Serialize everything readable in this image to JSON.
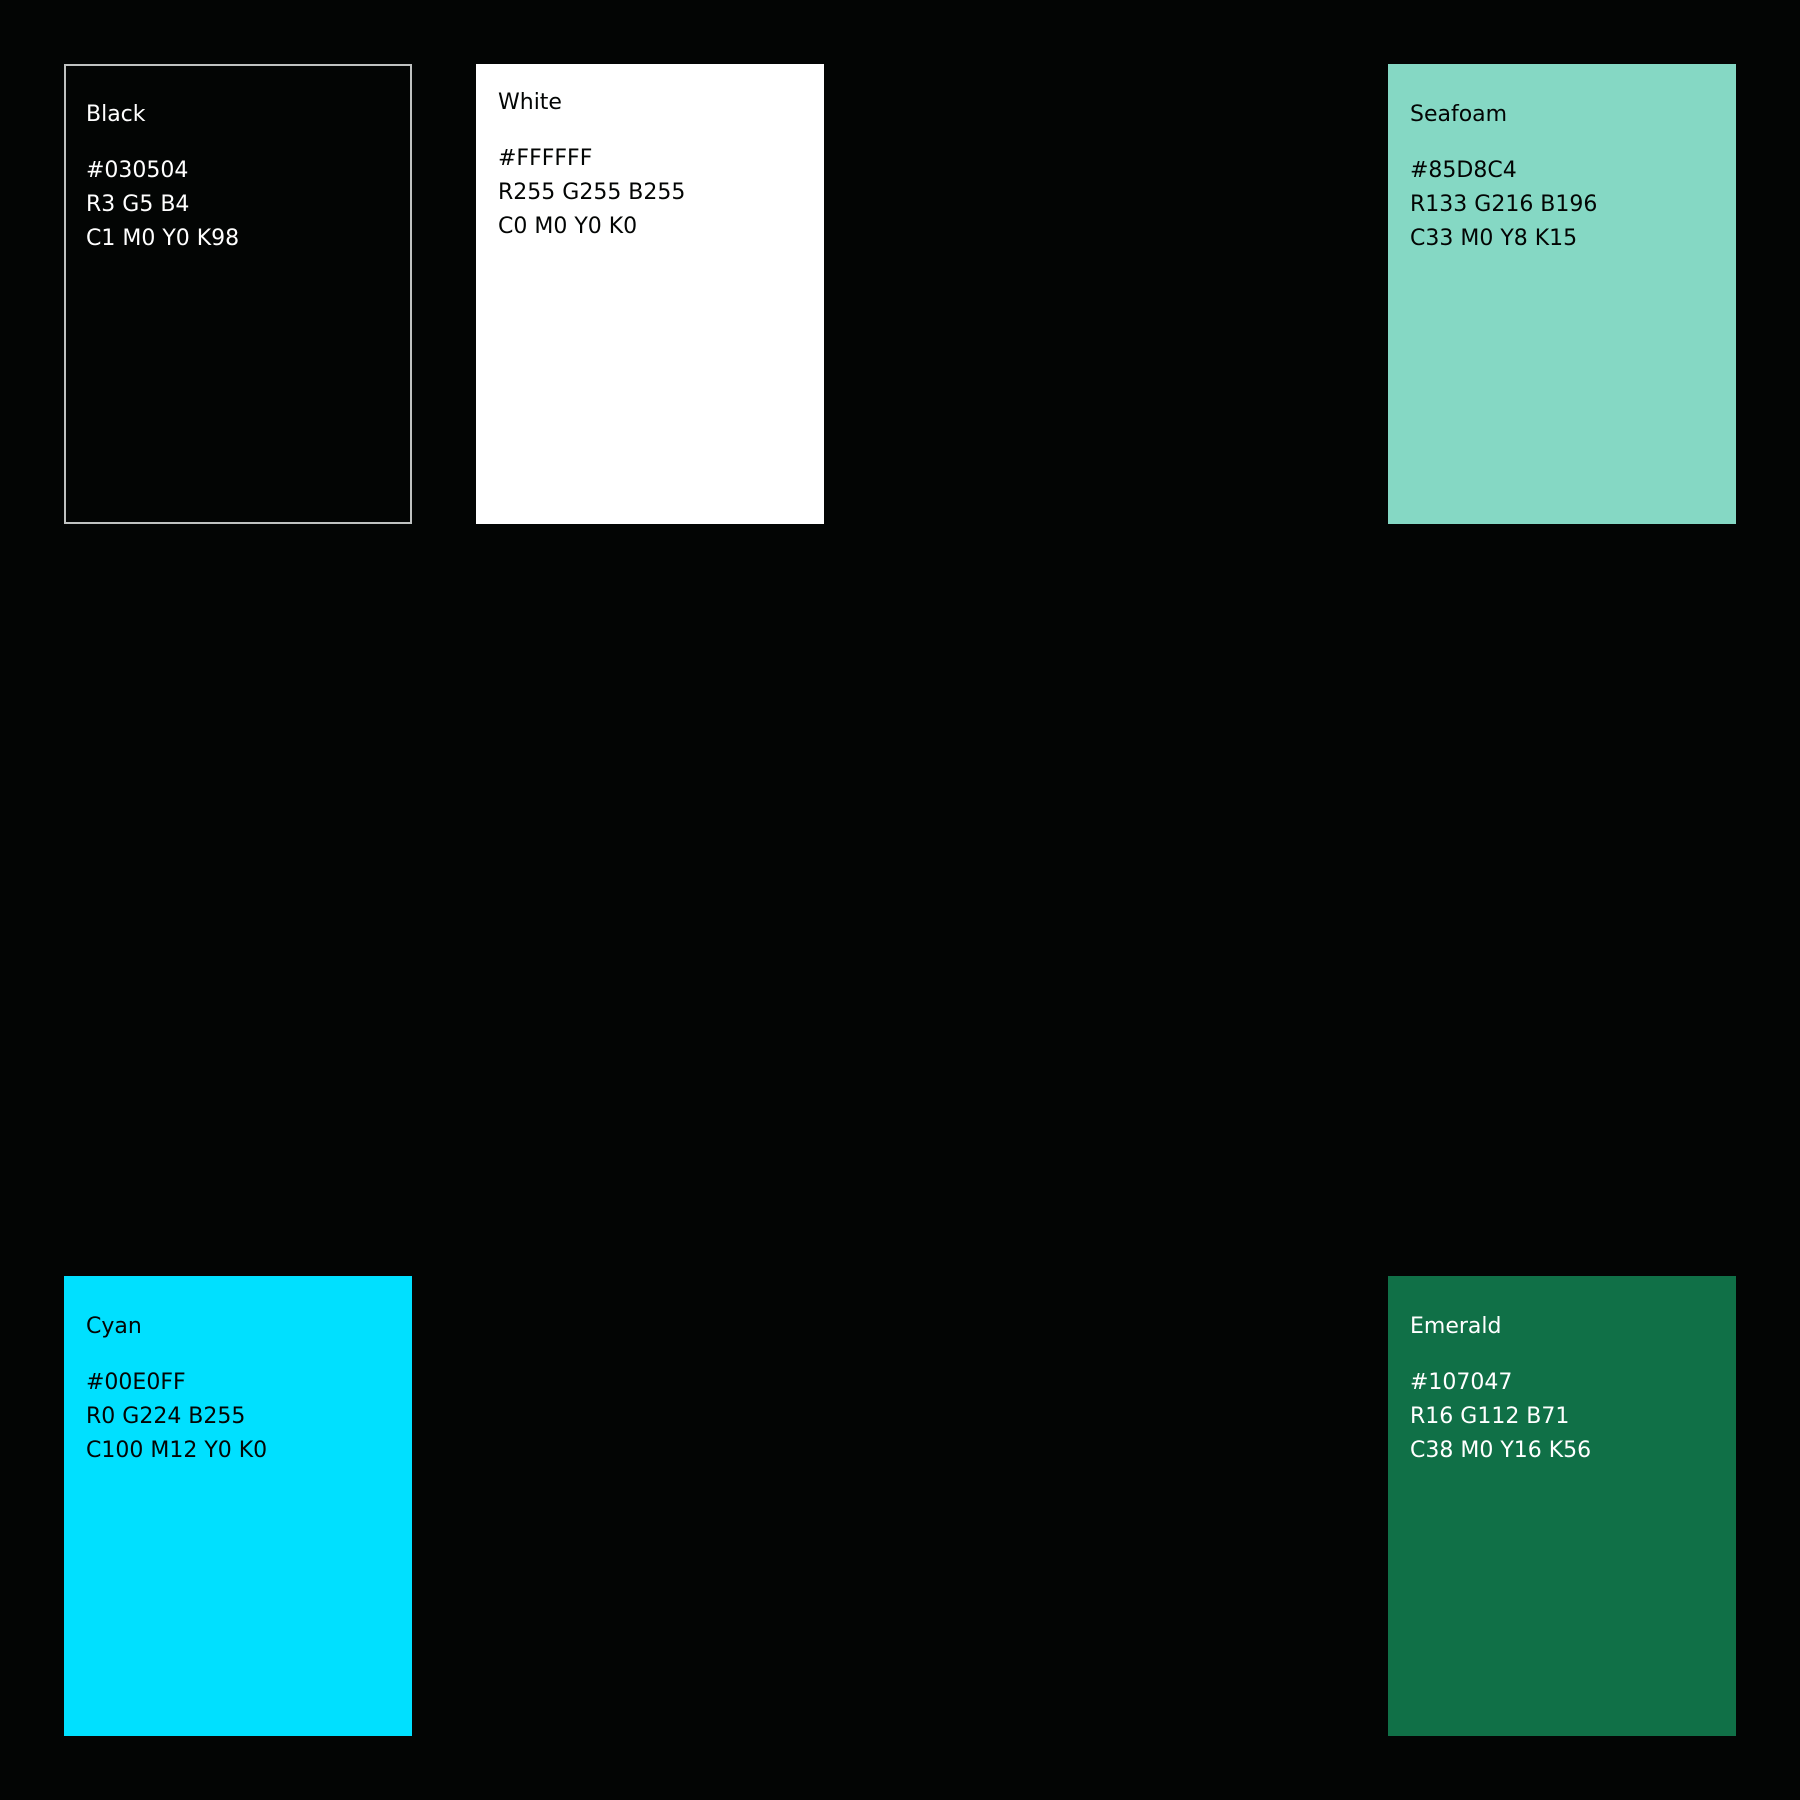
{
  "swatches": {
    "black": {
      "name": "Black",
      "hex": "#030504",
      "rgb": "R3 G5 B4",
      "cmyk": "C1 M0 Y0 K98",
      "fill": "#030504",
      "text_color": "#FFFFFF"
    },
    "white": {
      "name": "White",
      "hex": "#FFFFFF",
      "rgb": "R255 G255 B255",
      "cmyk": "C0 M0 Y0 K0",
      "fill": "#FFFFFF",
      "text_color": "#030504"
    },
    "seafoam": {
      "name": "Seafoam",
      "hex": "#85D8C4",
      "rgb": "R133 G216 B196",
      "cmyk": "C33 M0 Y8 K15",
      "fill": "#85D8C4",
      "text_color": "#030504"
    },
    "cyan": {
      "name": "Cyan",
      "hex": "#00E0FF",
      "rgb": "R0 G224 B255",
      "cmyk": "C100 M12 Y0 K0",
      "fill": "#00E0FF",
      "text_color": "#030504"
    },
    "emerald": {
      "name": "Emerald",
      "hex": "#107047",
      "rgb": "R16 G112 B71",
      "cmyk": "C38 M0 Y16 K56",
      "fill": "#107047",
      "text_color": "#FFFFFF"
    }
  }
}
